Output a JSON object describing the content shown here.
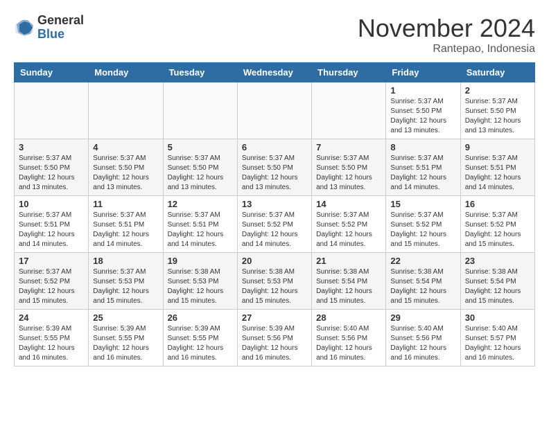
{
  "logo": {
    "general": "General",
    "blue": "Blue"
  },
  "title": "November 2024",
  "location": "Rantepao, Indonesia",
  "days_of_week": [
    "Sunday",
    "Monday",
    "Tuesday",
    "Wednesday",
    "Thursday",
    "Friday",
    "Saturday"
  ],
  "weeks": [
    [
      {
        "day": "",
        "info": ""
      },
      {
        "day": "",
        "info": ""
      },
      {
        "day": "",
        "info": ""
      },
      {
        "day": "",
        "info": ""
      },
      {
        "day": "",
        "info": ""
      },
      {
        "day": "1",
        "info": "Sunrise: 5:37 AM\nSunset: 5:50 PM\nDaylight: 12 hours\nand 13 minutes."
      },
      {
        "day": "2",
        "info": "Sunrise: 5:37 AM\nSunset: 5:50 PM\nDaylight: 12 hours\nand 13 minutes."
      }
    ],
    [
      {
        "day": "3",
        "info": "Sunrise: 5:37 AM\nSunset: 5:50 PM\nDaylight: 12 hours\nand 13 minutes."
      },
      {
        "day": "4",
        "info": "Sunrise: 5:37 AM\nSunset: 5:50 PM\nDaylight: 12 hours\nand 13 minutes."
      },
      {
        "day": "5",
        "info": "Sunrise: 5:37 AM\nSunset: 5:50 PM\nDaylight: 12 hours\nand 13 minutes."
      },
      {
        "day": "6",
        "info": "Sunrise: 5:37 AM\nSunset: 5:50 PM\nDaylight: 12 hours\nand 13 minutes."
      },
      {
        "day": "7",
        "info": "Sunrise: 5:37 AM\nSunset: 5:50 PM\nDaylight: 12 hours\nand 13 minutes."
      },
      {
        "day": "8",
        "info": "Sunrise: 5:37 AM\nSunset: 5:51 PM\nDaylight: 12 hours\nand 14 minutes."
      },
      {
        "day": "9",
        "info": "Sunrise: 5:37 AM\nSunset: 5:51 PM\nDaylight: 12 hours\nand 14 minutes."
      }
    ],
    [
      {
        "day": "10",
        "info": "Sunrise: 5:37 AM\nSunset: 5:51 PM\nDaylight: 12 hours\nand 14 minutes."
      },
      {
        "day": "11",
        "info": "Sunrise: 5:37 AM\nSunset: 5:51 PM\nDaylight: 12 hours\nand 14 minutes."
      },
      {
        "day": "12",
        "info": "Sunrise: 5:37 AM\nSunset: 5:51 PM\nDaylight: 12 hours\nand 14 minutes."
      },
      {
        "day": "13",
        "info": "Sunrise: 5:37 AM\nSunset: 5:52 PM\nDaylight: 12 hours\nand 14 minutes."
      },
      {
        "day": "14",
        "info": "Sunrise: 5:37 AM\nSunset: 5:52 PM\nDaylight: 12 hours\nand 14 minutes."
      },
      {
        "day": "15",
        "info": "Sunrise: 5:37 AM\nSunset: 5:52 PM\nDaylight: 12 hours\nand 15 minutes."
      },
      {
        "day": "16",
        "info": "Sunrise: 5:37 AM\nSunset: 5:52 PM\nDaylight: 12 hours\nand 15 minutes."
      }
    ],
    [
      {
        "day": "17",
        "info": "Sunrise: 5:37 AM\nSunset: 5:52 PM\nDaylight: 12 hours\nand 15 minutes."
      },
      {
        "day": "18",
        "info": "Sunrise: 5:37 AM\nSunset: 5:53 PM\nDaylight: 12 hours\nand 15 minutes."
      },
      {
        "day": "19",
        "info": "Sunrise: 5:38 AM\nSunset: 5:53 PM\nDaylight: 12 hours\nand 15 minutes."
      },
      {
        "day": "20",
        "info": "Sunrise: 5:38 AM\nSunset: 5:53 PM\nDaylight: 12 hours\nand 15 minutes."
      },
      {
        "day": "21",
        "info": "Sunrise: 5:38 AM\nSunset: 5:54 PM\nDaylight: 12 hours\nand 15 minutes."
      },
      {
        "day": "22",
        "info": "Sunrise: 5:38 AM\nSunset: 5:54 PM\nDaylight: 12 hours\nand 15 minutes."
      },
      {
        "day": "23",
        "info": "Sunrise: 5:38 AM\nSunset: 5:54 PM\nDaylight: 12 hours\nand 15 minutes."
      }
    ],
    [
      {
        "day": "24",
        "info": "Sunrise: 5:39 AM\nSunset: 5:55 PM\nDaylight: 12 hours\nand 16 minutes."
      },
      {
        "day": "25",
        "info": "Sunrise: 5:39 AM\nSunset: 5:55 PM\nDaylight: 12 hours\nand 16 minutes."
      },
      {
        "day": "26",
        "info": "Sunrise: 5:39 AM\nSunset: 5:55 PM\nDaylight: 12 hours\nand 16 minutes."
      },
      {
        "day": "27",
        "info": "Sunrise: 5:39 AM\nSunset: 5:56 PM\nDaylight: 12 hours\nand 16 minutes."
      },
      {
        "day": "28",
        "info": "Sunrise: 5:40 AM\nSunset: 5:56 PM\nDaylight: 12 hours\nand 16 minutes."
      },
      {
        "day": "29",
        "info": "Sunrise: 5:40 AM\nSunset: 5:56 PM\nDaylight: 12 hours\nand 16 minutes."
      },
      {
        "day": "30",
        "info": "Sunrise: 5:40 AM\nSunset: 5:57 PM\nDaylight: 12 hours\nand 16 minutes."
      }
    ]
  ]
}
